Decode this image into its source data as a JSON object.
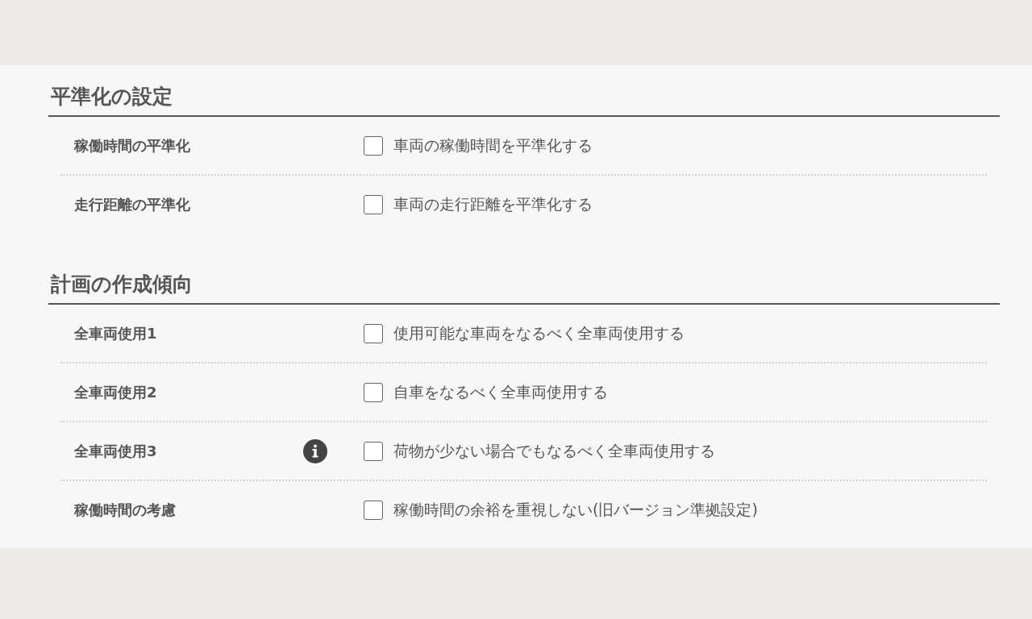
{
  "sections": [
    {
      "title": "平準化の設定",
      "rows": [
        {
          "label": "稼働時間の平準化",
          "info": false,
          "option": {
            "text": "車両の稼働時間を平準化する",
            "checked": false
          }
        },
        {
          "label": "走行距離の平準化",
          "info": false,
          "option": {
            "text": "車両の走行距離を平準化する",
            "checked": false
          }
        }
      ]
    },
    {
      "title": "計画の作成傾向",
      "rows": [
        {
          "label": "全車両使用1",
          "info": false,
          "option": {
            "text": "使用可能な車両をなるべく全車両使用する",
            "checked": false
          }
        },
        {
          "label": "全車両使用2",
          "info": false,
          "option": {
            "text": "自車をなるべく全車両使用する",
            "checked": false
          }
        },
        {
          "label": "全車両使用3",
          "info": true,
          "option": {
            "text": "荷物が少ない場合でもなるべく全車両使用する",
            "checked": false
          }
        },
        {
          "label": "稼働時間の考慮",
          "info": false,
          "option": {
            "text": "稼働時間の余裕を重視しない(旧バージョン準拠設定)",
            "checked": false
          }
        }
      ]
    }
  ]
}
